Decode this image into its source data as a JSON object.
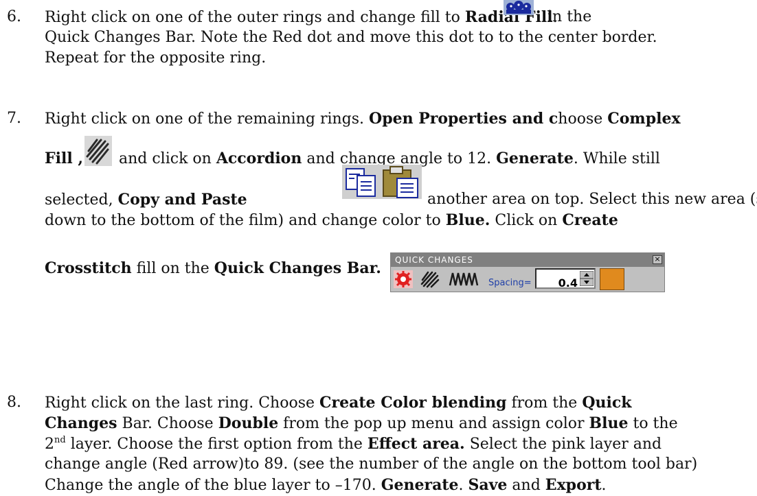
{
  "step6": {
    "number": "6.",
    "l1_a": "Right click on one of the outer rings and change fill to ",
    "l1_b": "Radial Fill",
    "l1_c": ".",
    "l1_d": "in the",
    "l2": "Quick Changes Bar.  Note the Red dot and move this dot to to the center border.",
    "l3": "Repeat for the opposite ring."
  },
  "step7": {
    "number": "7.",
    "l1_a": "Right click on one of the remaining rings. ",
    "l1_b": "Open Properties and c",
    "l1_c": "hoose ",
    "l1_d": "Complex",
    "l2_a": "Fill ,",
    "l2_b": " and click on ",
    "l2_c": "Accordion",
    "l2_d": " and change angle to 12. ",
    "l2_e": "Generate",
    "l2_f": ".  While still",
    "l3_a": "selected, ",
    "l3_b": "Copy and Paste",
    "l3_c": "another area on top.  Select this new area (slide",
    "l4_a": "down to the bottom of the film) and change color to ",
    "l4_b": "Blue.",
    "l4_c": "  Click on ",
    "l4_d": "Create",
    "l5_a": "Crosstitch",
    "l5_b": " fill on the ",
    "l5_c": "Quick Changes Bar."
  },
  "quick_changes": {
    "title": "QUICK CHANGES",
    "close": "×",
    "spacing_label": "Spacing=",
    "spacing_value": "0.4",
    "color": "#e08a1e"
  },
  "step8": {
    "number": "8.",
    "l1_a": "Right click on the last ring.  Choose ",
    "l1_b": "Create Color blending",
    "l1_c": " from the ",
    "l1_d": "Quick",
    "l2_a": "Changes",
    "l2_b": " Bar. Choose ",
    "l2_c": "Double",
    "l2_d": " from the pop up menu and assign color ",
    "l2_e": "Blue",
    "l2_f": " to the",
    "l3_a": "2",
    "l3_sup": "nd",
    "l3_b": " layer. Choose the first option from the ",
    "l3_c": "Effect area.",
    "l3_d": "  Select the pink layer and",
    "l4": "change angle (Red arrow)to 89. (see the number of the angle on the bottom tool bar)",
    "l5_a": "Change the angle of the blue layer to –170. ",
    "l5_b": "Generate",
    "l5_c": ". ",
    "l5_d": "Save",
    "l5_e": " and ",
    "l5_f": "Export",
    "l5_g": "."
  }
}
